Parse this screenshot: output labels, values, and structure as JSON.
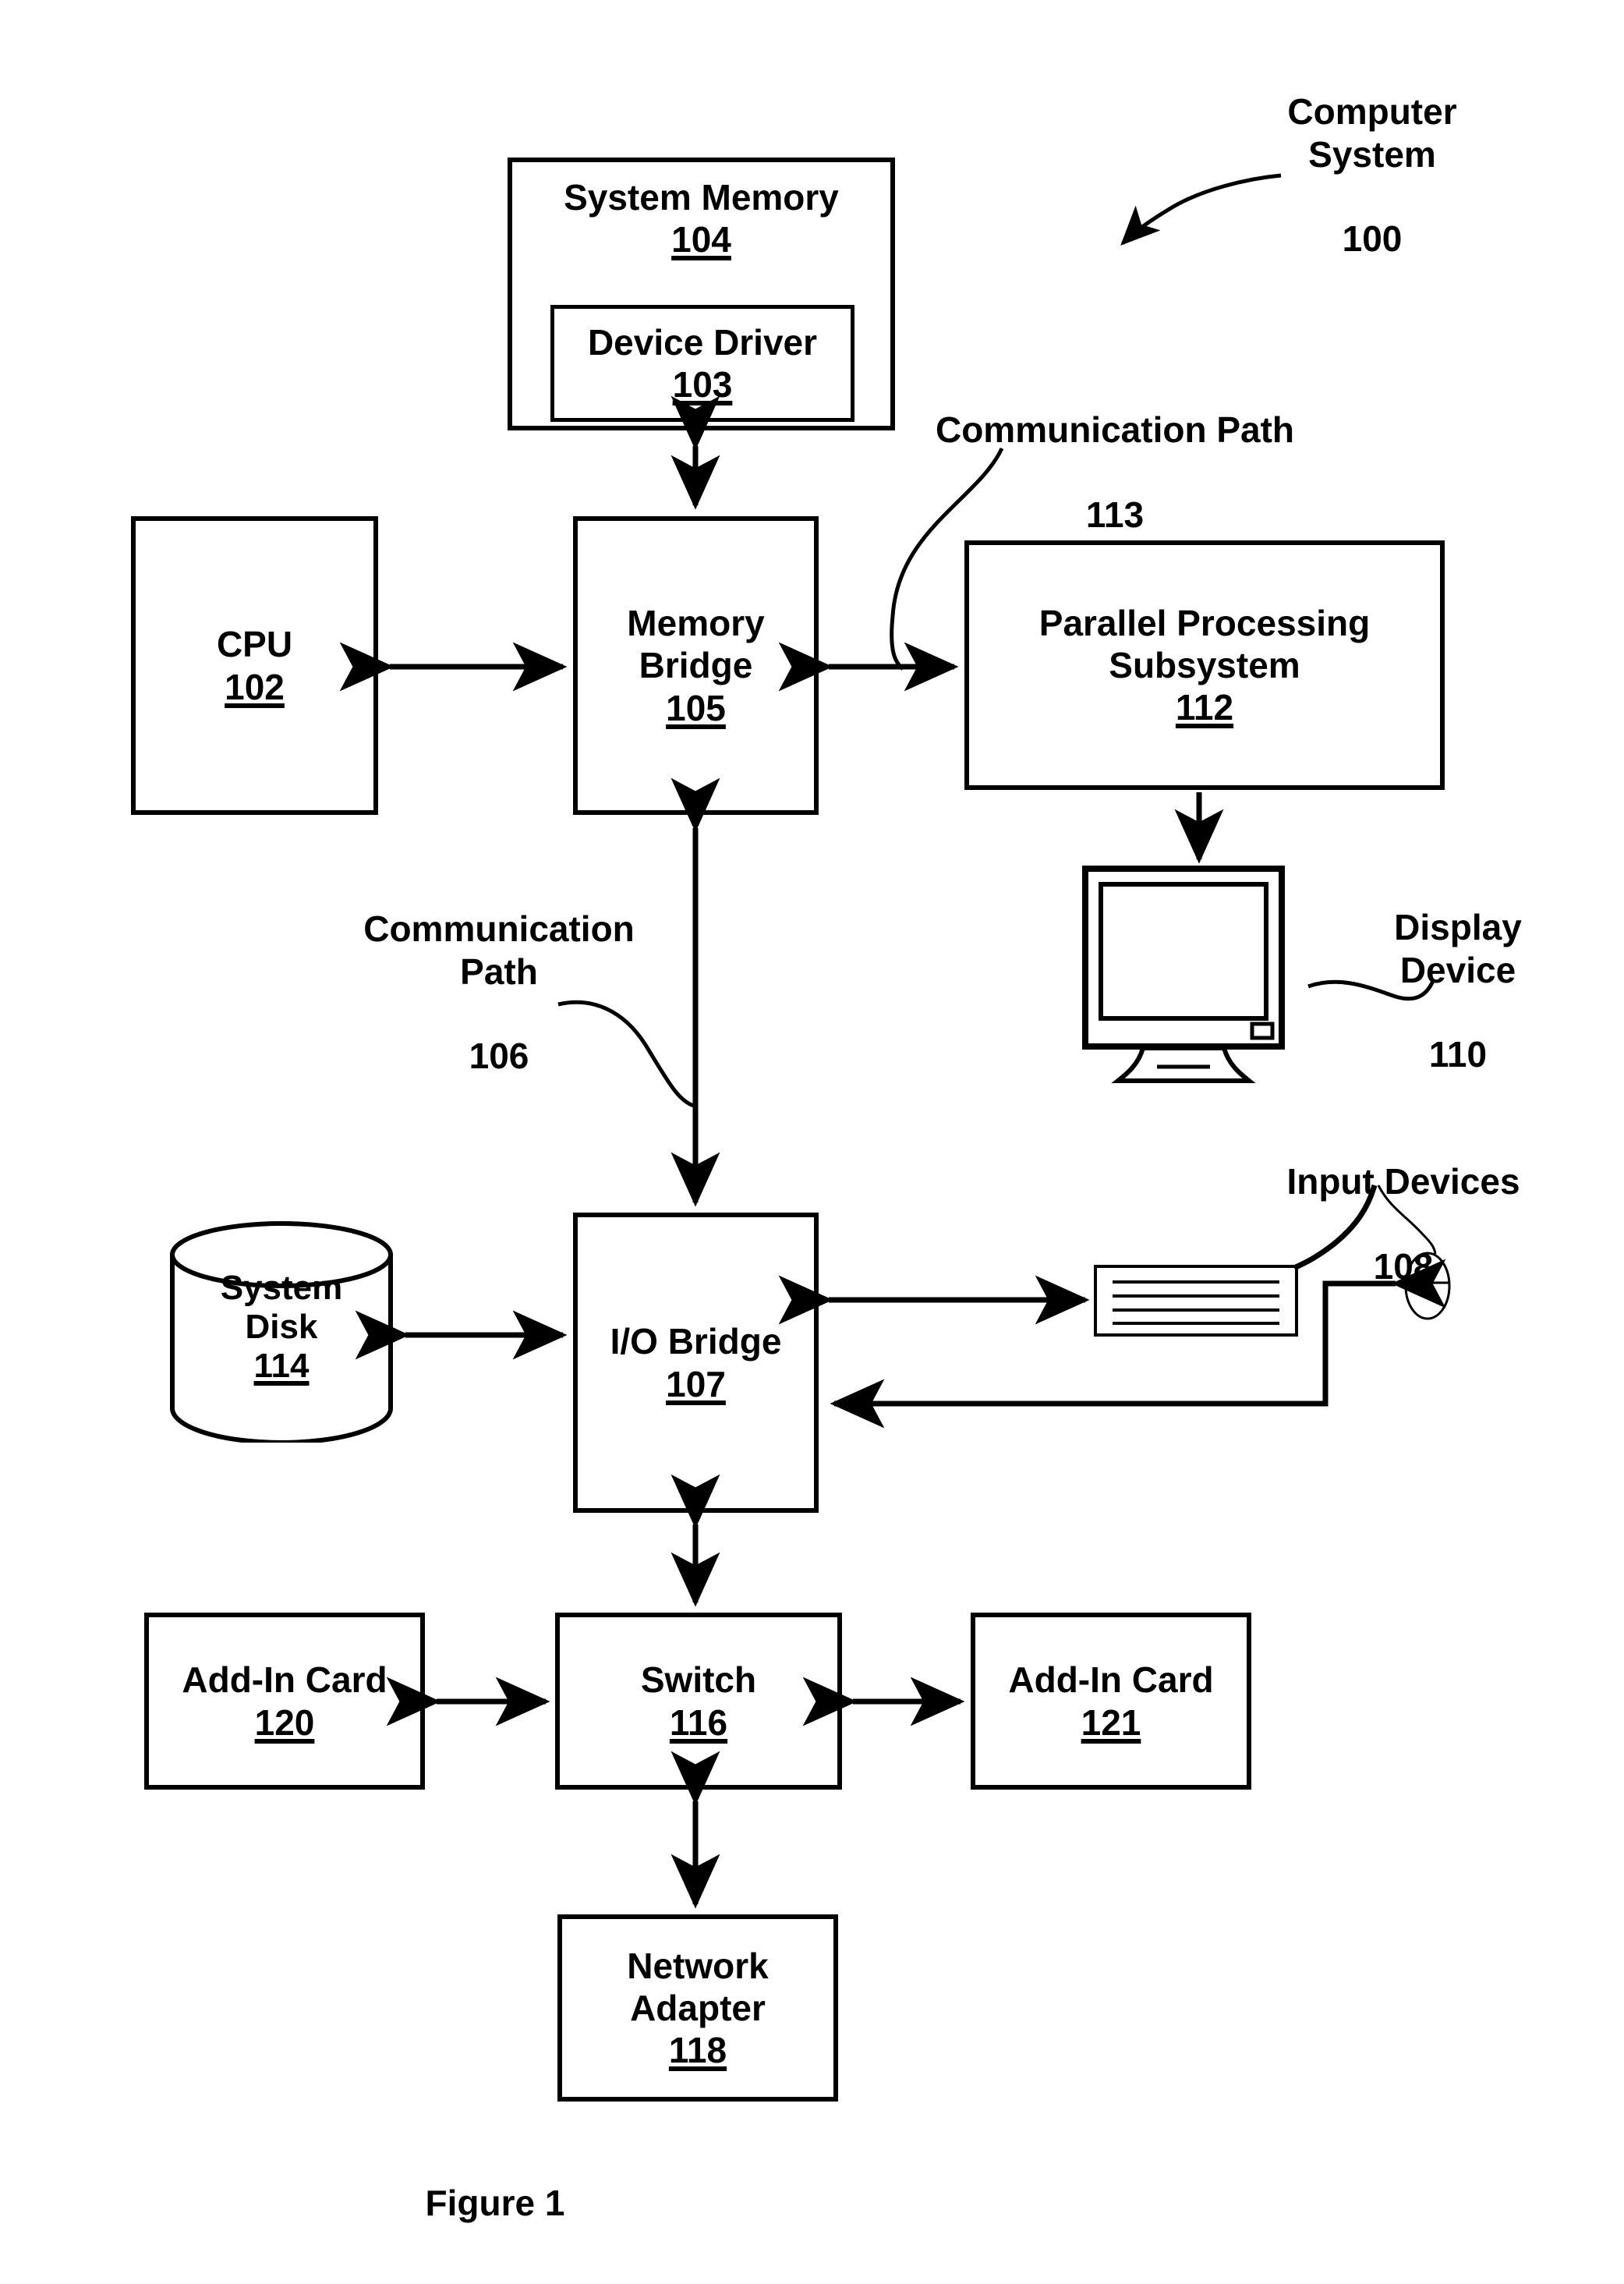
{
  "figure": {
    "caption": "Figure 1"
  },
  "callouts": {
    "computer_system": {
      "label": "Computer\nSystem",
      "number": "100"
    },
    "communication_path_113": {
      "label": "Communication Path",
      "number": "113"
    },
    "communication_path_106": {
      "label": "Communication\nPath",
      "number": "106"
    },
    "display_device": {
      "label": "Display\nDevice",
      "number": "110"
    },
    "input_devices": {
      "label": "Input Devices",
      "number": "108"
    }
  },
  "blocks": {
    "system_memory": {
      "label": "System Memory",
      "number": "104"
    },
    "device_driver": {
      "label": "Device Driver",
      "number": "103"
    },
    "cpu": {
      "label": "CPU",
      "number": "102"
    },
    "memory_bridge": {
      "label": "Memory\nBridge",
      "number": "105"
    },
    "parallel_processing_subsystem": {
      "label": "Parallel Processing\nSubsystem",
      "number": "112"
    },
    "io_bridge": {
      "label": "I/O Bridge",
      "number": "107"
    },
    "system_disk": {
      "label": "System\nDisk",
      "number": "114"
    },
    "add_in_card_120": {
      "label": "Add-In Card",
      "number": "120"
    },
    "switch": {
      "label": "Switch",
      "number": "116"
    },
    "add_in_card_121": {
      "label": "Add-In Card",
      "number": "121"
    },
    "network_adapter": {
      "label": "Network\nAdapter",
      "number": "118"
    }
  },
  "icons": {
    "display_device": "monitor-icon",
    "keyboard": "keyboard-icon",
    "mouse": "mouse-icon",
    "system_disk": "database-cylinder-icon"
  },
  "colors": {
    "stroke": "#000000",
    "background": "#ffffff"
  }
}
